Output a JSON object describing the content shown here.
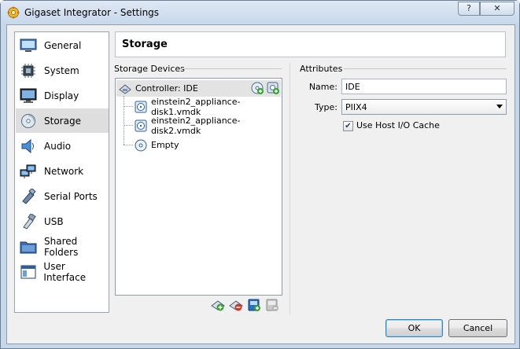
{
  "window": {
    "title": "Gigaset Integrator - Settings",
    "help_label": "?",
    "close_label": "✕"
  },
  "sidebar": {
    "items": [
      {
        "label": "General",
        "icon": "general-icon"
      },
      {
        "label": "System",
        "icon": "chip-icon"
      },
      {
        "label": "Display",
        "icon": "monitor-icon"
      },
      {
        "label": "Storage",
        "icon": "storage-icon",
        "selected": true
      },
      {
        "label": "Audio",
        "icon": "speaker-icon"
      },
      {
        "label": "Network",
        "icon": "network-icon"
      },
      {
        "label": "Serial Ports",
        "icon": "serial-port-icon"
      },
      {
        "label": "USB",
        "icon": "usb-icon"
      },
      {
        "label": "Shared Folders",
        "icon": "folder-icon"
      },
      {
        "label": "User Interface",
        "icon": "window-icon"
      }
    ]
  },
  "page": {
    "title": "Storage"
  },
  "storage_devices": {
    "group_label": "Storage Devices",
    "controller": {
      "label": "Controller: IDE"
    },
    "attachments": [
      {
        "label": "einstein2_appliance-disk1.vmdk",
        "icon": "hard-disk-icon"
      },
      {
        "label": "einstein2_appliance-disk2.vmdk",
        "icon": "hard-disk-icon"
      },
      {
        "label": "Empty",
        "icon": "optical-disc-icon"
      }
    ]
  },
  "attributes": {
    "group_label": "Attributes",
    "name_label": "Name:",
    "name_value": "IDE",
    "type_label": "Type:",
    "type_value": "PIIX4",
    "host_cache_label": "Use Host I/O Cache",
    "host_cache_checked": true
  },
  "buttons": {
    "ok": "OK",
    "cancel": "Cancel"
  },
  "colors": {
    "accent_green": "#3aa03a",
    "accent_blue": "#2a6fc0",
    "selection": "#dedede"
  }
}
